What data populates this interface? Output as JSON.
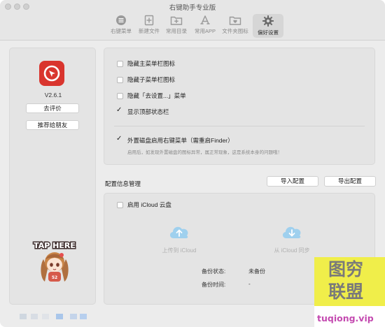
{
  "window": {
    "title": "右键助手专业版"
  },
  "toolbar": {
    "items": [
      {
        "label": "右键菜单",
        "icon": "list-icon"
      },
      {
        "label": "新建文件",
        "icon": "new-file-icon"
      },
      {
        "label": "常用目录",
        "icon": "folder-plus-icon"
      },
      {
        "label": "常用APP",
        "icon": "app-store-icon"
      },
      {
        "label": "文件夹图标",
        "icon": "folder-heart-icon"
      },
      {
        "label": "偏好设置",
        "icon": "gear-icon"
      }
    ],
    "active_index": 5
  },
  "sidebar": {
    "version": "V2.6.1",
    "rate_label": "去评价",
    "recommend_label": "推荐给朋友",
    "mascot_text": "TAP HERE",
    "logo_color": "#d9352e"
  },
  "settings": {
    "hide_main_menubar_icon": {
      "label": "隐藏主菜单栏图标",
      "checked": false
    },
    "hide_sub_menubar_icon": {
      "label": "隐藏子菜单栏图标",
      "checked": false
    },
    "hide_goto_settings_menu": {
      "label": "隐藏「去设置...」菜单",
      "checked": false
    },
    "show_top_statusbar": {
      "label": "显示顶部状态栏",
      "checked": true
    },
    "external_disk_menu": {
      "label": "外置磁盘启用右键菜单（需重启Finder）",
      "checked": true
    },
    "external_disk_hint": "启用后，如发现外置磁盘的图标异常，属正常现象，这是系统本身的问题哦！"
  },
  "config": {
    "section_title": "配置信息管理",
    "import_label": "导入配置",
    "export_label": "导出配置",
    "icloud_toggle": {
      "label": "启用 iCloud 云盘",
      "checked": false
    },
    "upload_label": "上传到 iCloud",
    "sync_label": "从 iCloud 同步",
    "backup_status_label": "备份状态:",
    "backup_status_value": "未备份",
    "backup_time_label": "备份时间:",
    "backup_time_value": "-"
  },
  "watermark": {
    "line1": "图穷",
    "line2": "联盟",
    "url": "tuqiong.vip"
  },
  "colors": {
    "accent_red": "#d9352e",
    "cloud_blue": "#9fd0ee",
    "watermark_yellow": "#f0ee4a",
    "watermark_url": "#c44ab0"
  }
}
